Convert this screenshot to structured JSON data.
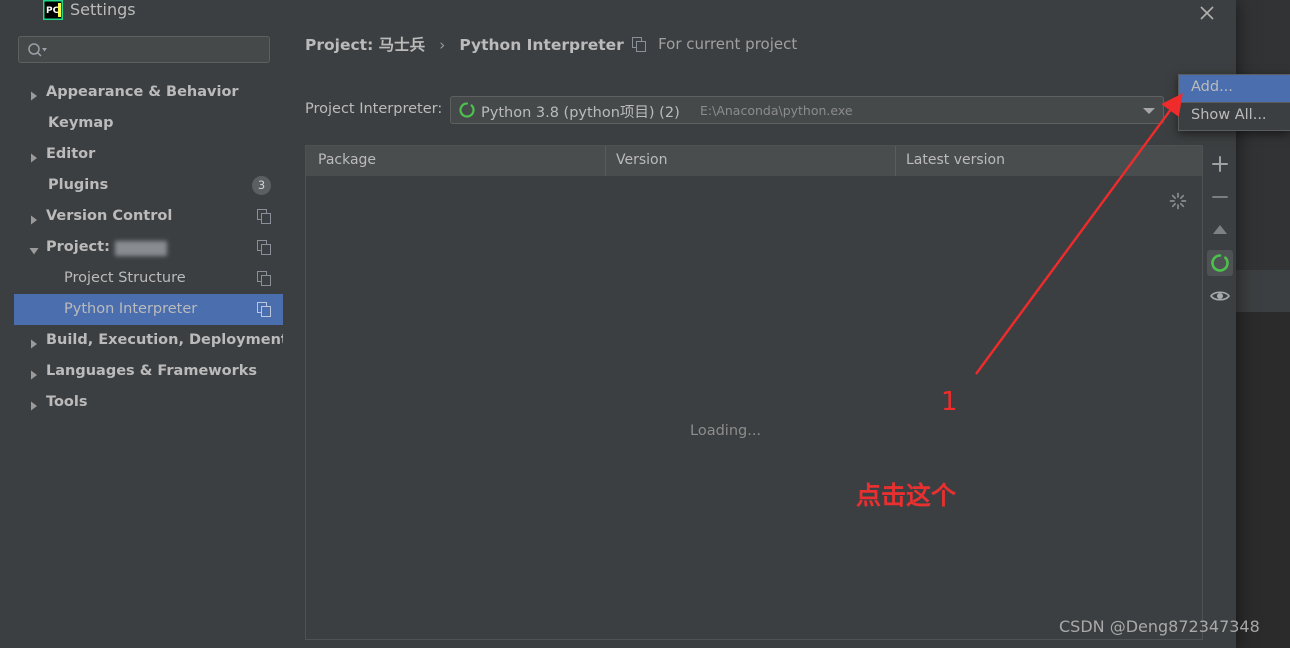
{
  "window": {
    "title": "Settings",
    "app_icon": "pycharm-icon",
    "close_icon": "close-icon"
  },
  "search": {
    "value": "",
    "placeholder": "",
    "icon": "search-icon"
  },
  "sidebar": {
    "items": [
      {
        "label": "Appearance & Behavior",
        "arrow": "collapsed",
        "style": "bold",
        "badge": null,
        "copy_icon": false,
        "selected": false
      },
      {
        "label": "Keymap",
        "arrow": "none",
        "style": "bold",
        "badge": null,
        "copy_icon": false,
        "selected": false
      },
      {
        "label": "Editor",
        "arrow": "collapsed",
        "style": "bold",
        "badge": null,
        "copy_icon": false,
        "selected": false
      },
      {
        "label": "Plugins",
        "arrow": "none",
        "style": "bold",
        "badge": "3",
        "copy_icon": false,
        "selected": false
      },
      {
        "label": "Version Control",
        "arrow": "collapsed",
        "style": "bold",
        "badge": null,
        "copy_icon": true,
        "selected": false
      },
      {
        "label": "Project:",
        "arrow": "expanded",
        "style": "bold",
        "badge": null,
        "copy_icon": true,
        "selected": false,
        "redacted": true
      },
      {
        "label": "Project Structure",
        "arrow": "none",
        "style": "child",
        "badge": null,
        "copy_icon": true,
        "selected": false
      },
      {
        "label": "Python Interpreter",
        "arrow": "none",
        "style": "child",
        "badge": null,
        "copy_icon": true,
        "selected": true
      },
      {
        "label": "Build, Execution, Deployment",
        "arrow": "collapsed",
        "style": "bold",
        "badge": null,
        "copy_icon": false,
        "selected": false
      },
      {
        "label": "Languages & Frameworks",
        "arrow": "collapsed",
        "style": "bold",
        "badge": null,
        "copy_icon": false,
        "selected": false
      },
      {
        "label": "Tools",
        "arrow": "collapsed",
        "style": "bold",
        "badge": null,
        "copy_icon": false,
        "selected": false
      }
    ]
  },
  "main": {
    "breadcrumb": {
      "project": "Project: 马士兵",
      "separator": "›",
      "page": "Python Interpreter"
    },
    "for_current_project": {
      "label": "For current project",
      "icon": "copy-icon"
    },
    "interpreter": {
      "label": "Project Interpreter:",
      "env_icon": "conda-env-icon",
      "name": "Python 3.8 (python项目) (2)",
      "path": "E:\\Anaconda\\python.exe",
      "arrow_icon": "chevron-down-icon"
    },
    "table": {
      "columns": [
        "Package",
        "Version",
        "Latest version"
      ],
      "rows": [],
      "loading_text": "Loading...",
      "spinner_icon": "loading-spinner-icon"
    },
    "toolbar": [
      {
        "name": "add-package-button",
        "icon": "plus-icon",
        "active": false
      },
      {
        "name": "remove-package-button",
        "icon": "minus-icon",
        "active": false
      },
      {
        "name": "upgrade-package-button",
        "icon": "triangle-up-icon",
        "active": false
      },
      {
        "name": "refresh-button",
        "icon": "conda-refresh-icon",
        "active": true
      },
      {
        "name": "show-early-releases-button",
        "icon": "eye-icon",
        "active": false
      }
    ]
  },
  "popup": {
    "items": [
      {
        "label": "Add...",
        "selected": true
      },
      {
        "label": "Show All...",
        "selected": false
      }
    ]
  },
  "annotations": {
    "number_one": "1",
    "click_this": "点击这个",
    "arrow_color": "#ef2b2b"
  },
  "watermark": {
    "text": "CSDN @Deng872347348"
  },
  "colors": {
    "dialog_bg": "#3c3f41",
    "ide_bg": "#2b2b2b",
    "selection_blue": "#4b6eaf",
    "text": "#bbbbbb",
    "accent_red": "#ef2b2b",
    "green_env": "#57a64a"
  }
}
